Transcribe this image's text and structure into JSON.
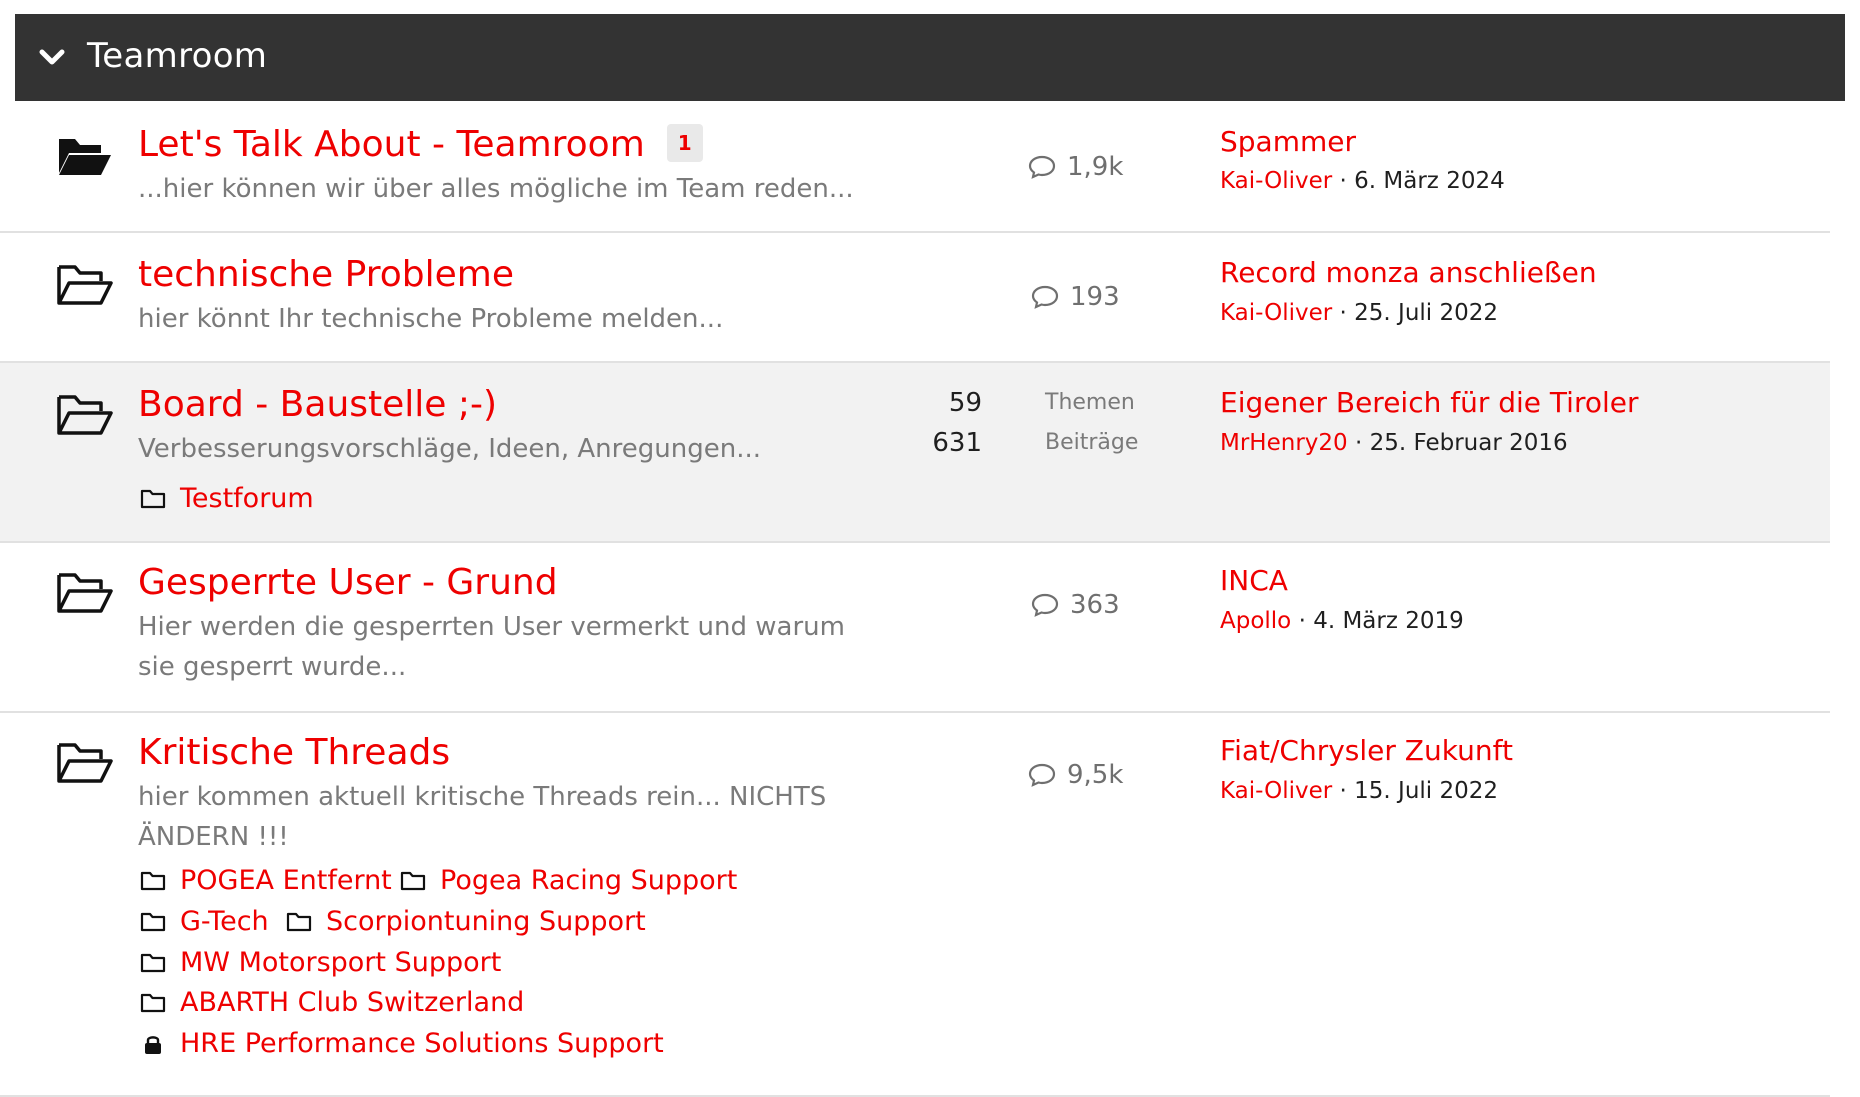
{
  "block": {
    "title": "Teamroom"
  },
  "nodes": [
    {
      "title": "Let's Talk About - Teamroom",
      "badge": "1",
      "description": "...hier können wir über alles mögliche im Team reden...",
      "messages": "1,9k",
      "last": {
        "title": "Spammer",
        "user": "Kai-Oliver",
        "sep": "·",
        "date": "6. März 2024"
      }
    },
    {
      "title": "technische Probleme",
      "description": "hier könnt Ihr technische Probleme melden...",
      "messages": "193",
      "last": {
        "title": "Record monza anschließen",
        "user": "Kai-Oliver",
        "sep": "·",
        "date": "25. Juli 2022"
      }
    },
    {
      "title": "Board - Baustelle ;-)",
      "description": "Verbesserungsvorschläge, Ideen, Anregungen...",
      "threads_num": "59",
      "threads_label": "Themen",
      "posts_num": "631",
      "posts_label": "Beiträge",
      "subforums": [
        "Testforum"
      ],
      "last": {
        "title": "Eigener Bereich für die Tiroler",
        "user": "MrHenry20",
        "sep": "·",
        "date": "25. Februar 2016"
      }
    },
    {
      "title": "Gesperrte User - Grund",
      "description_line1": "Hier werden die gesperrten User vermerkt und warum",
      "description_line2": "sie gesperrt wurde...",
      "messages": "363",
      "last": {
        "title": "INCA",
        "user": "Apollo",
        "sep": "·",
        "date": "4. März 2019"
      }
    },
    {
      "title": "Kritische Threads",
      "description_line1": "hier kommen aktuell kritische Threads rein... NICHTS",
      "description_line2": "ÄNDERN !!!",
      "messages": "9,5k",
      "subforums": [
        "POGEA Entfernt",
        "Pogea Racing Support",
        "G-Tech",
        "Scorpiontuning Support",
        "MW Motorsport Support",
        "ABARTH Club Switzerland",
        "HRE Performance Solutions Support"
      ],
      "last": {
        "title": "Fiat/Chrysler Zukunft",
        "user": "Kai-Oliver",
        "sep": "·",
        "date": "15. Juli 2022"
      }
    }
  ]
}
